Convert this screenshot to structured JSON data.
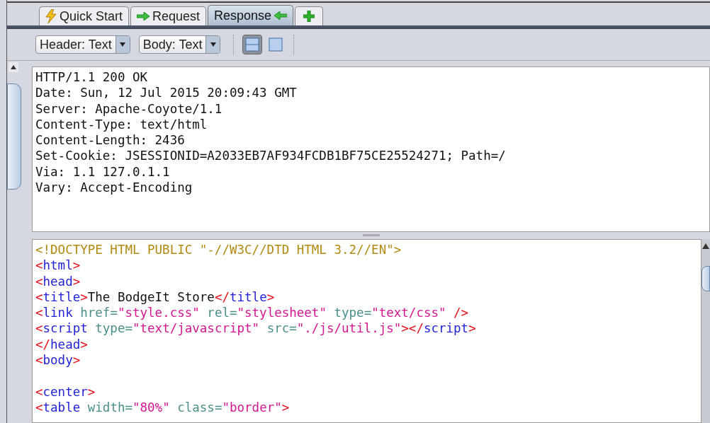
{
  "tabs": [
    {
      "label": "Quick Start",
      "selected": false
    },
    {
      "label": "Request",
      "selected": false
    },
    {
      "label": "Response",
      "selected": true
    }
  ],
  "toolbar": {
    "dropdowns": [
      "Header: Text",
      "Body: Text"
    ],
    "layout_buttons": [
      {
        "selected": true
      },
      {
        "selected": false
      }
    ]
  },
  "header_lines": [
    "HTTP/1.1 200 OK",
    "Date: Sun, 12 Jul 2015 20:09:43 GMT",
    "Server: Apache-Coyote/1.1",
    "Content-Type: text/html",
    "Content-Length: 2436",
    "Set-Cookie: JSESSIONID=A2033EB7AF934FCDB1BF75CE25524271; Path=/",
    "Via: 1.1 127.0.1.1",
    "Vary: Accept-Encoding"
  ],
  "body_lines": [
    {
      "kind": "code",
      "tokens": [
        {
          "kind": "doctype",
          "text": "<!DOCTYPE HTML PUBLIC \"-//W3C//DTD HTML 3.2//EN\">"
        }
      ]
    },
    {
      "kind": "code",
      "tokens": [
        {
          "kind": "bracket",
          "text": "<"
        },
        {
          "kind": "tag",
          "text": "html"
        },
        {
          "kind": "bracket",
          "text": ">"
        }
      ]
    },
    {
      "kind": "code",
      "tokens": [
        {
          "kind": "bracket",
          "text": "<"
        },
        {
          "kind": "tag",
          "text": "head"
        },
        {
          "kind": "bracket",
          "text": ">"
        }
      ]
    },
    {
      "kind": "code",
      "tokens": [
        {
          "kind": "bracket",
          "text": "<"
        },
        {
          "kind": "tag",
          "text": "title"
        },
        {
          "kind": "bracket",
          "text": ">"
        },
        {
          "kind": "text",
          "text": "The BodgeIt Store"
        },
        {
          "kind": "bracket",
          "text": "</"
        },
        {
          "kind": "tag",
          "text": "title"
        },
        {
          "kind": "bracket",
          "text": ">"
        }
      ]
    },
    {
      "kind": "code",
      "tokens": [
        {
          "kind": "bracket",
          "text": "<"
        },
        {
          "kind": "tag",
          "text": "link"
        },
        {
          "kind": "attr",
          "text": " href="
        },
        {
          "kind": "value",
          "text": "\"style.css\""
        },
        {
          "kind": "attr",
          "text": " rel="
        },
        {
          "kind": "value",
          "text": "\"stylesheet\""
        },
        {
          "kind": "attr",
          "text": " type="
        },
        {
          "kind": "value",
          "text": "\"text/css\""
        },
        {
          "kind": "bracket",
          "text": " />"
        }
      ]
    },
    {
      "kind": "code",
      "tokens": [
        {
          "kind": "bracket",
          "text": "<"
        },
        {
          "kind": "tag",
          "text": "script"
        },
        {
          "kind": "attr",
          "text": " type="
        },
        {
          "kind": "value",
          "text": "\"text/javascript\""
        },
        {
          "kind": "attr",
          "text": " src="
        },
        {
          "kind": "value",
          "text": "\"./js/util.js\""
        },
        {
          "kind": "bracket",
          "text": "></"
        },
        {
          "kind": "tag",
          "text": "script"
        },
        {
          "kind": "bracket",
          "text": ">"
        }
      ]
    },
    {
      "kind": "code",
      "tokens": [
        {
          "kind": "bracket",
          "text": "</"
        },
        {
          "kind": "tag",
          "text": "head"
        },
        {
          "kind": "bracket",
          "text": ">"
        }
      ]
    },
    {
      "kind": "code",
      "tokens": [
        {
          "kind": "bracket",
          "text": "<"
        },
        {
          "kind": "tag",
          "text": "body"
        },
        {
          "kind": "bracket",
          "text": ">"
        }
      ]
    },
    {
      "kind": "blank"
    },
    {
      "kind": "code",
      "tokens": [
        {
          "kind": "bracket",
          "text": "<"
        },
        {
          "kind": "tag",
          "text": "center"
        },
        {
          "kind": "bracket",
          "text": ">"
        }
      ]
    },
    {
      "kind": "code",
      "tokens": [
        {
          "kind": "bracket",
          "text": "<"
        },
        {
          "kind": "tag",
          "text": "table"
        },
        {
          "kind": "attr",
          "text": " width="
        },
        {
          "kind": "value",
          "text": "\"80%\""
        },
        {
          "kind": "attr",
          "text": " class="
        },
        {
          "kind": "value",
          "text": "\"border\""
        },
        {
          "kind": "bracket",
          "text": ">"
        }
      ]
    }
  ]
}
